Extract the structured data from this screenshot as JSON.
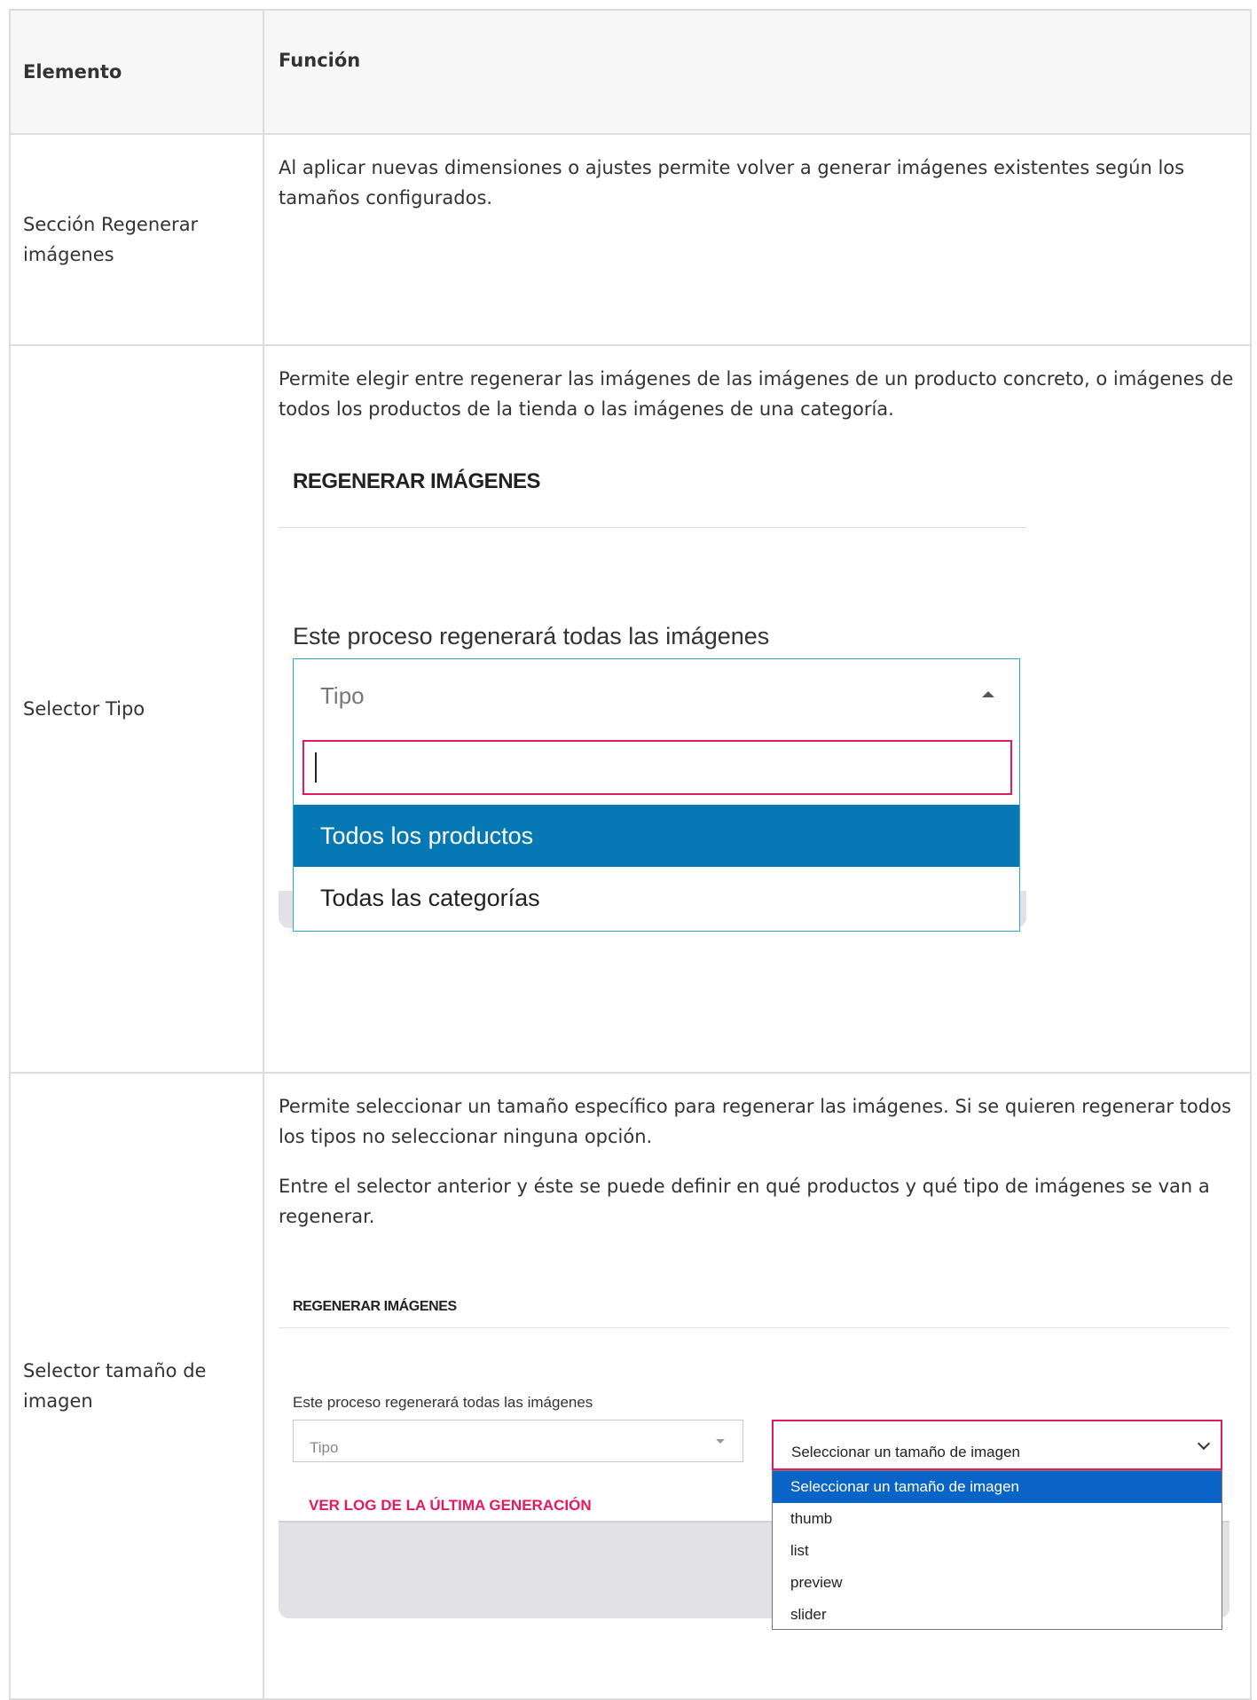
{
  "table": {
    "header_element": "Elemento",
    "header_function": "Función"
  },
  "rows": [
    {
      "element": "Sección Regenerar imágenes",
      "function": "Al aplicar nuevas dimensiones o ajustes permite volver a generar imágenes existentes según los tamaños configurados."
    },
    {
      "element": "Selector Tipo",
      "function": "Permite elegir entre regenerar las imágenes de las imágenes de un producto concreto, o imágenes de todos los productos de la tienda o las imágenes de una categoría."
    },
    {
      "element": "Selector tamaño de imagen",
      "function_p1": "Permite seleccionar un tamaño específico para regenerar las imágenes. Si se quieren regenerar todos los tipos no seleccionar ninguna opción.",
      "function_p2": "Entre el selector anterior y éste se puede definir en qué productos y qué tipo de imágenes se van a regenerar."
    }
  ],
  "screenshot1": {
    "title": "REGENERAR IMÁGENES",
    "description": "Este proceso regenerará todas las imágenes",
    "dropdown_placeholder": "Tipo",
    "search_value": "",
    "options": [
      "Todos los productos",
      "Todas las categorías"
    ],
    "selected_index": 0
  },
  "screenshot2": {
    "title": "REGENERAR IMÁGENES",
    "description": "Este proceso regenerará todas las imágenes",
    "tipo_placeholder": "Tipo",
    "size_select_label": "Seleccionar un tamaño de imagen",
    "log_link": "VER LOG DE LA ÚLTIMA GENERACIÓN",
    "size_options": [
      "Seleccionar un tamaño de imagen",
      "thumb",
      "list",
      "preview",
      "slider"
    ],
    "selected_index": 0
  },
  "colors": {
    "accent_pink": "#e5195e",
    "selected_blue": "#0678b4",
    "select_blue": "#0a64c8",
    "focus_border": "#2ea6dc"
  }
}
